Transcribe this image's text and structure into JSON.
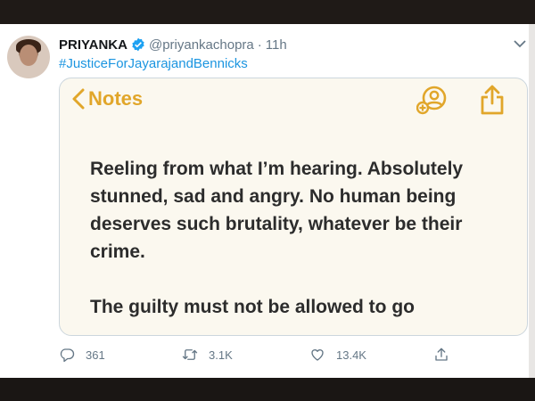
{
  "tweet": {
    "author_name": "PRIYANKA",
    "handle": "@priyankachopra",
    "separator": "·",
    "time": "11h",
    "hashtag": "#JusticeForJayarajandBennicks"
  },
  "notes_screenshot": {
    "back_label": "Notes",
    "paragraph_1": "Reeling from what I’m hearing. Absolutely stunned, sad and angry. No human being deserves such brutality, whatever be their crime.",
    "paragraph_2": "The guilty must not be allowed  to go"
  },
  "actions": {
    "reply_count": "361",
    "retweet_count": "3.1K",
    "like_count": "13.4K"
  },
  "colors": {
    "link_blue": "#1b95e0",
    "notes_accent": "#e1a62a",
    "muted_text": "#657786",
    "verified_blue": "#1da1f2"
  },
  "icons": {
    "verified": "verified-badge-icon",
    "menu": "chevron-down-icon",
    "back": "chevron-left-icon",
    "collaborate": "add-person-icon",
    "share_sheet": "share-icon",
    "reply": "reply-icon",
    "retweet": "retweet-icon",
    "like": "heart-icon",
    "share": "share-arrow-icon"
  }
}
